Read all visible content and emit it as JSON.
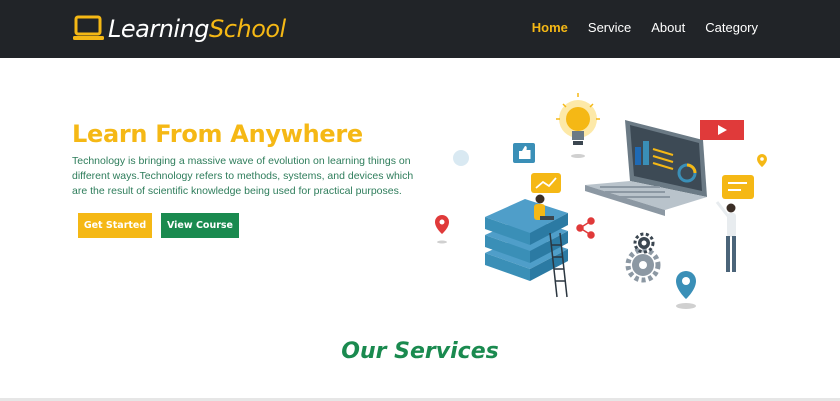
{
  "navbar": {
    "brand": {
      "part1": "Learning",
      "part2": "School",
      "icon": "laptop-icon"
    },
    "links": [
      {
        "label": "Home",
        "active": true
      },
      {
        "label": "Service",
        "active": false
      },
      {
        "label": "About",
        "active": false
      },
      {
        "label": "Category",
        "active": false
      }
    ]
  },
  "hero": {
    "title": "Learn From Anywhere",
    "description": "Technology is bringing a massive wave of evolution on learning things on different ways.Technology refers to methods, systems, and devices which are the result of scientific knowledge being used for practical purposes.",
    "primary_button": "Get Started",
    "secondary_button": "View Course"
  },
  "services": {
    "title": "Our Services"
  },
  "colors": {
    "accent": "#f5b815",
    "green": "#1a8a4f",
    "navbar": "#212428",
    "teal": "#3a8fb7"
  }
}
